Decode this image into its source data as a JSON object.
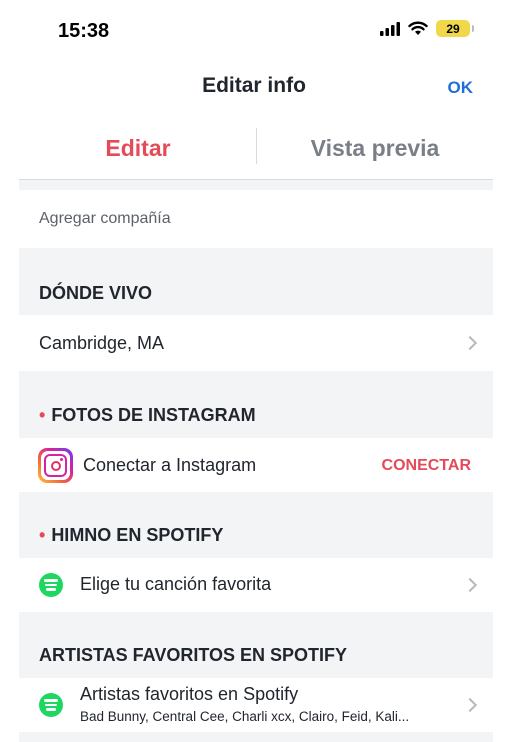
{
  "status_bar": {
    "time": "15:38",
    "battery": "29"
  },
  "nav": {
    "title": "Editar info",
    "ok_label": "OK"
  },
  "tabs": [
    {
      "label": "Editar",
      "active": true
    },
    {
      "label": "Vista previa",
      "active": false
    }
  ],
  "rows": {
    "company": {
      "placeholder": "Agregar compañía"
    }
  },
  "sections": {
    "where_i_live": {
      "header": "DÓNDE VIVO",
      "value": "Cambridge, MA"
    },
    "instagram": {
      "header": "FOTOS DE INSTAGRAM",
      "label": "Conectar a Instagram",
      "action": "CONECTAR",
      "icon": "instagram-icon"
    },
    "anthem": {
      "header": "HIMNO EN SPOTIFY",
      "label": "Elige tu canción favorita",
      "icon": "spotify-icon"
    },
    "artists": {
      "header": "ARTISTAS FAVORITOS EN SPOTIFY",
      "label": "Artistas favoritos en Spotify",
      "subtitle": "Bad Bunny, Central Cee, Charli xcx, Clairo, Feid, Kali...",
      "icon": "spotify-icon"
    }
  },
  "colors": {
    "accent": "#e54a59",
    "link": "#1f6fd6",
    "spotify": "#1ed760",
    "section_bg": "#f3f4f5"
  }
}
